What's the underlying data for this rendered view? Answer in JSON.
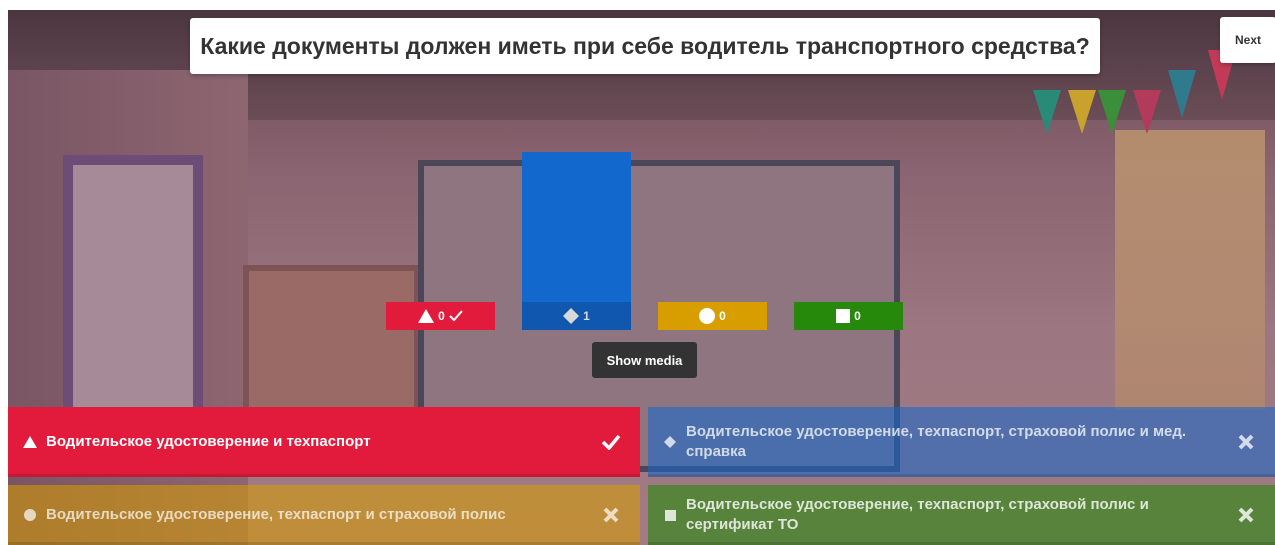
{
  "question": "Какие документы должен иметь при себе водитель транспортного средства?",
  "next_label": "Next",
  "show_media_label": "Show media",
  "chart_data": {
    "type": "bar",
    "categories": [
      "triangle",
      "diamond",
      "circle",
      "square"
    ],
    "values": [
      0,
      1,
      0,
      0
    ],
    "value_labels": [
      "0",
      "1",
      "0",
      "0"
    ],
    "correct": [
      true,
      false,
      false,
      false
    ],
    "colors": [
      "#e21b3c",
      "#1368ce",
      "#d89e00",
      "#26890c"
    ],
    "ylim": [
      0,
      1
    ],
    "title": "",
    "xlabel": "",
    "ylabel": ""
  },
  "answers": [
    {
      "shape": "triangle-icon",
      "text": "Водительское удостоверение и техпаспорт",
      "correct": true,
      "color": "#e21b3c"
    },
    {
      "shape": "diamond-icon",
      "text": "Водительское удостоверение, техпаспорт, страховой полис и мед. справка",
      "correct": false,
      "color": "#1368ce"
    },
    {
      "shape": "circle-icon",
      "text": "Водительское удостоверение, техпаспорт и страховой полис",
      "correct": false,
      "color": "#d89e00"
    },
    {
      "shape": "square-icon",
      "text": "Водительское удостоверение, техпаспорт, страховой полис и сертификат ТО",
      "correct": false,
      "color": "#26890c"
    }
  ]
}
